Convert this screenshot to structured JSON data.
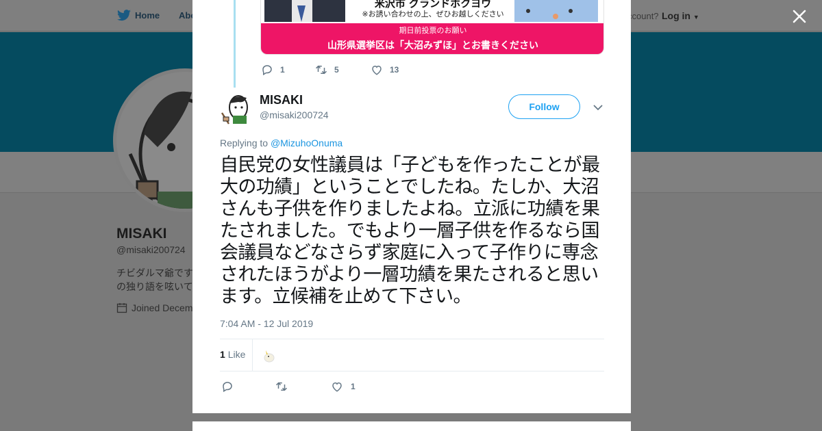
{
  "nav": {
    "home": "Home",
    "about": "Abo",
    "have_account": "ccount?",
    "login": "Log in"
  },
  "profile_bg": {
    "name": "MISAKI",
    "handle": "@misaki200724",
    "bio_line1": "チビダルマ爺です",
    "bio_line2": "の独り語を呟いて",
    "joined": "Joined Decem"
  },
  "quoted_image": {
    "line1": "米沢市 グランドホクヨウ",
    "line2": "※お誘い合わせの上、ぜひお越しください",
    "line3": "期日前投票のお願い",
    "line4": "山形県選挙区は「大沼みずほ」とお書きください"
  },
  "parent_tweet_actions": {
    "replies": "1",
    "retweets": "5",
    "likes": "13"
  },
  "tweet": {
    "author_name": "MISAKI",
    "author_handle": "@misaki200724",
    "follow_label": "Follow",
    "replying_prefix": "Replying to ",
    "replying_to": "@MizuhoOnuma",
    "text": "自民党の女性議員は「子どもを作ったことが最大の功績」ということでしたね。たしか、大沼さんも子供を作りましたよね。立派に功績を果たされました。でもより一層子供を作るなら国会議員などなさらず家庭に入って子作りに専念されたほうがより一層功績を果たされると思います。立候補を止めて下さい。",
    "timestamp": "7:04 AM - 12 Jul 2019",
    "likes_number": "1",
    "likes_label": "Like",
    "action_like_count": "1"
  },
  "colors": {
    "accent": "#1da1f2",
    "banner": "#054b5f",
    "pink_band": "#ee1566"
  },
  "icons": [
    "twitter-bird-icon",
    "close-icon",
    "reply-icon",
    "retweet-icon",
    "heart-icon",
    "chevron-down-icon",
    "calendar-icon"
  ]
}
